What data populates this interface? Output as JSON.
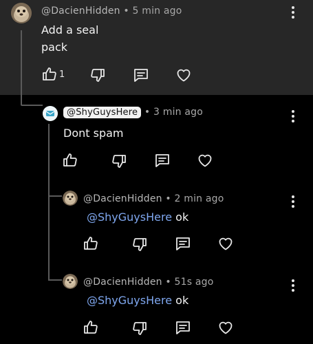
{
  "comments": [
    {
      "author": "@DacienHidden",
      "time": "5 min ago",
      "text": "Add a seal\npack",
      "likes": "1"
    },
    {
      "author": "@ShyGuysHere",
      "time": "3 min ago",
      "text": "Dont spam"
    },
    {
      "author": "@DacienHidden",
      "time": "2 min ago",
      "mention": "@ShyGuysHere",
      "text": " ok"
    },
    {
      "author": "@DacienHidden",
      "time": "51s ago",
      "mention": "@ShyGuysHere",
      "text": " ok"
    }
  ],
  "separator": " • ",
  "icons": {
    "like": "thumbs-up-icon",
    "dislike": "thumbs-down-icon",
    "reply": "comment-icon",
    "heart": "heart-icon",
    "menu": "more-vertical-icon"
  },
  "colors": {
    "background": "#000000",
    "highlighted_background": "#272727",
    "mention": "#7fa7ef",
    "meta": "#a8a8a8"
  }
}
